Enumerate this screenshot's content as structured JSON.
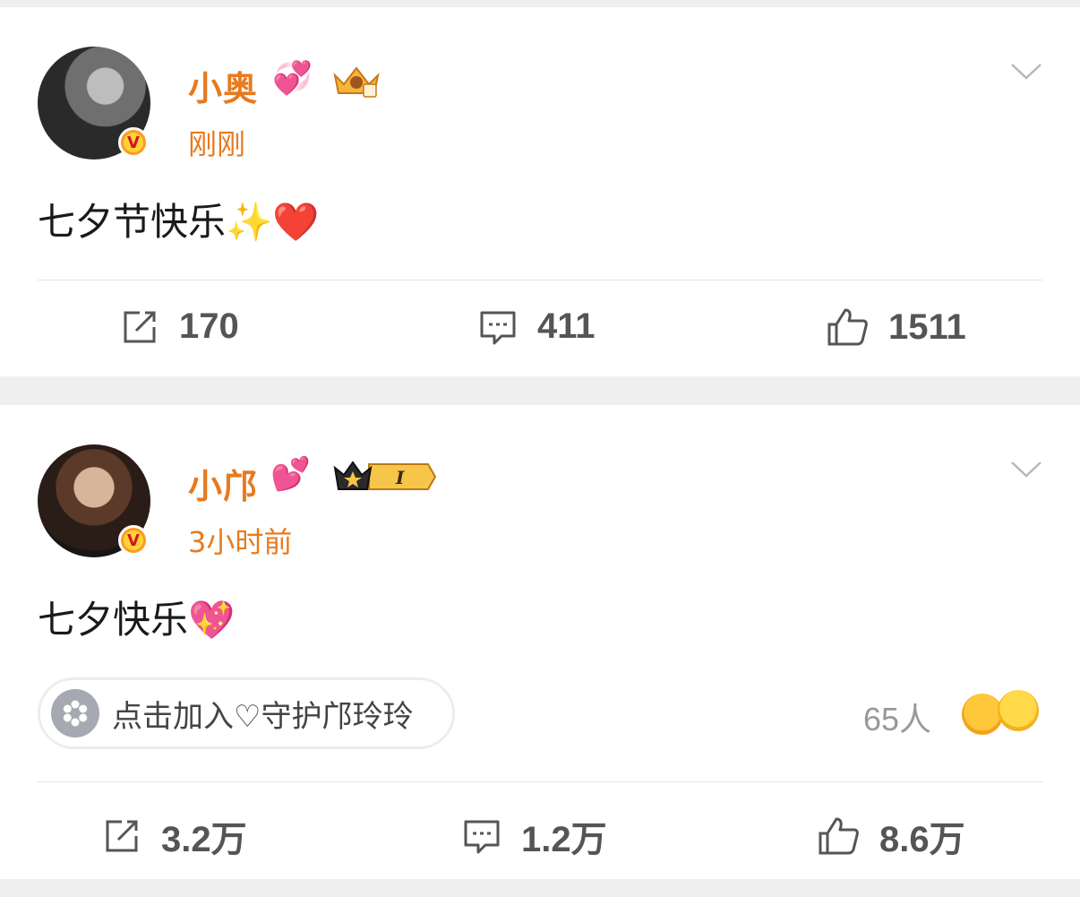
{
  "posts": [
    {
      "username": "小奥",
      "name_emoji": "💞",
      "time": "刚刚",
      "verified_badge": "V",
      "content": "七夕节快乐",
      "content_emojis": "✨❤️",
      "actions": {
        "repost": "170",
        "comment": "411",
        "like": "1511"
      }
    },
    {
      "username": "小邝",
      "name_emoji": "💕",
      "level_badge": "I",
      "time": "3小时前",
      "verified_badge": "V",
      "content": "七夕快乐",
      "content_emojis": "💖",
      "fan_club": {
        "label": "点击加入♡守护邝玲玲",
        "count": "65人"
      },
      "actions": {
        "repost": "3.2万",
        "comment": "1.2万",
        "like": "8.6万"
      }
    }
  ],
  "icons": {
    "repost": "repost-icon",
    "comment": "comment-icon",
    "like": "thumbs-up-icon",
    "more": "chevron-down-icon",
    "fan_club": "asterisk-icon"
  },
  "colors": {
    "username": "#e87a1e",
    "background": "#efefef",
    "card": "#ffffff",
    "icon_gray": "#555555"
  }
}
